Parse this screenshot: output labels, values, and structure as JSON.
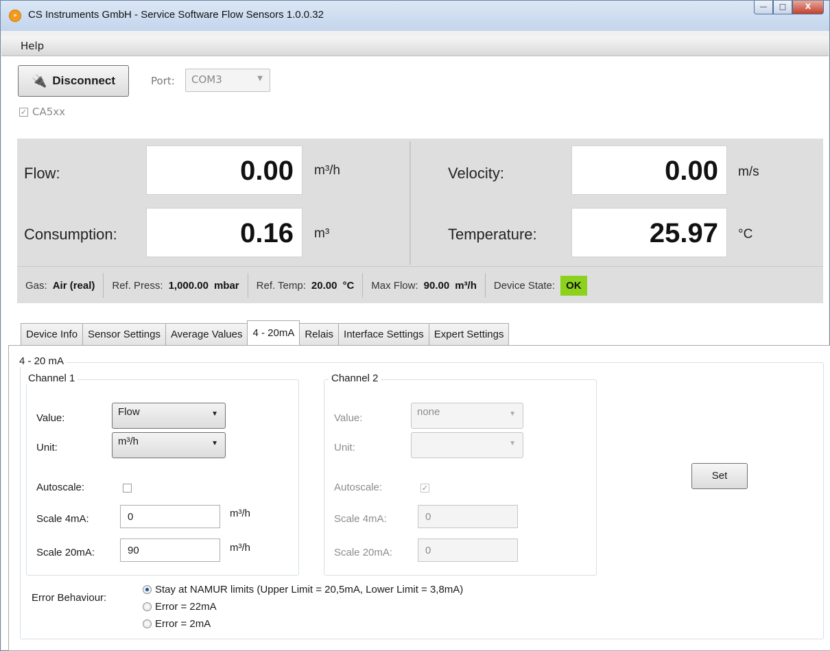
{
  "window": {
    "title": "CS Instruments GmbH - Service Software Flow Sensors  1.0.0.32",
    "app_icon_glyph": "»",
    "controls": {
      "minimize": "—",
      "maximize": "□",
      "close": "X"
    }
  },
  "menu": {
    "help": "Help"
  },
  "connection": {
    "disconnect_label": "Disconnect",
    "plug_glyph": "🔌",
    "port_label": "Port:",
    "port_value": "COM3",
    "ca5xx_label": "CA5xx",
    "ca5xx_checked": true
  },
  "measurements": {
    "flow_label": "Flow:",
    "flow_value": "0.00",
    "flow_unit": "m³/h",
    "consumption_label": "Consumption:",
    "consumption_value": "0.16",
    "consumption_unit": "m³",
    "velocity_label": "Velocity:",
    "velocity_value": "0.00",
    "velocity_unit": "m/s",
    "temperature_label": "Temperature:",
    "temperature_value": "25.97",
    "temperature_unit": "°C"
  },
  "status": {
    "gas_label": "Gas:",
    "gas_value": "Air (real)",
    "refpress_label": "Ref. Press:",
    "refpress_value": "1,000.00",
    "refpress_unit": "mbar",
    "reftemp_label": "Ref. Temp:",
    "reftemp_value": "20.00",
    "reftemp_unit": "°C",
    "maxflow_label": "Max Flow:",
    "maxflow_value": "90.00",
    "maxflow_unit": "m³/h",
    "devstate_label": "Device State:",
    "devstate_value": "OK",
    "ok_color": "#8cd21c"
  },
  "tabs": [
    "Device Info",
    "Sensor Settings",
    "Average Values",
    "4 - 20mA",
    "Relais",
    "Interface Settings",
    "Expert Settings"
  ],
  "active_tab": "4 - 20mA",
  "panel": {
    "group_title": "4 - 20 mA",
    "channel1": {
      "title": "Channel 1",
      "value_label": "Value:",
      "value": "Flow",
      "unit_label": "Unit:",
      "unit": "m³/h",
      "autoscale_label": "Autoscale:",
      "autoscale_checked": false,
      "scale4_label": "Scale 4mA:",
      "scale4_value": "0",
      "scale4_unit": "m³/h",
      "scale20_label": "Scale 20mA:",
      "scale20_value": "90",
      "scale20_unit": "m³/h"
    },
    "channel2": {
      "title": "Channel 2",
      "value_label": "Value:",
      "value": "none",
      "unit_label": "Unit:",
      "unit": "",
      "autoscale_label": "Autoscale:",
      "autoscale_checked": true,
      "scale4_label": "Scale 4mA:",
      "scale4_value": "0",
      "scale20_label": "Scale 20mA:",
      "scale20_value": "0"
    },
    "set_label": "Set",
    "error_behaviour_label": "Error Behaviour:",
    "error_options": [
      "Stay at NAMUR limits (Upper Limit = 20,5mA, Lower Limit = 3,8mA)",
      "Error = 22mA",
      "Error = 2mA"
    ],
    "error_selected": 0
  }
}
